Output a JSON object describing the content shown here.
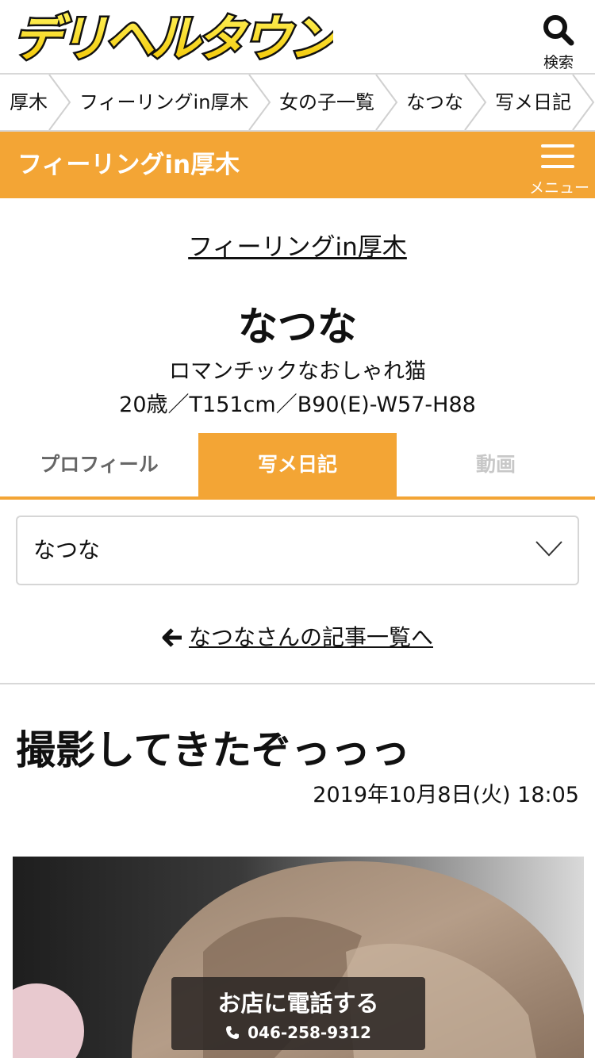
{
  "header": {
    "logo_text": "デリヘルタウン",
    "search_label": "検索"
  },
  "breadcrumb": [
    "厚木",
    "フィーリングin厚木",
    "女の子一覧",
    "なつな",
    "写メ日記"
  ],
  "shop_bar": {
    "title": "フィーリングin厚木",
    "menu_label": "メニュー"
  },
  "profile": {
    "shop_link": "フィーリングin厚木",
    "name": "なつな",
    "catchphrase": "ロマンチックなおしゃれ猫",
    "specs": "20歳／T151cm／B90(E)-W57-H88"
  },
  "tabs": [
    "プロフィール",
    "写メ日記",
    "動画"
  ],
  "select": {
    "value": "なつな"
  },
  "back_link": "なつなさんの記事一覧へ",
  "post": {
    "title": "撮影してきたぞっっっ",
    "date": "2019年10月8日(火) 18:05"
  },
  "call": {
    "label": "お店に電話する",
    "phone": "046-258-9312"
  },
  "colors": {
    "accent": "#f3a535",
    "logo_yellow": "#ffe600",
    "text": "#111111",
    "border": "#d8d8d8"
  }
}
